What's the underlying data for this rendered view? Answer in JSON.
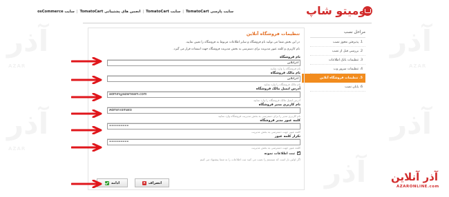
{
  "header": {
    "links": [
      "سایت پارسی TomatoCart",
      "سایت TomatoCart",
      "انجمن های پشتیبانی TomatoCart",
      "سایت osCommerce"
    ],
    "logo_text": "توميتو شاپ"
  },
  "sidebar": {
    "title": "مراحل نصب",
    "steps": [
      "1. پذیرفتن مجوز نصب",
      "2. بررسی قبل از نصب",
      "3. تنظیمات بانک اطلاعات",
      "4. تنظیمات سرور وب",
      "5. تنظیمات فروشگاه آنلاین",
      "6. پایان نصب"
    ]
  },
  "main": {
    "title": "تنظیمات فروشگاه آنلاین",
    "intro_1": "در این بخش شما می توانید نام فروشگاه و سایر اطلاعات مربوط به فروشگاه را تعیین نمایید.",
    "intro_2": "نام کاربری و کلمه عبور مدیریت برای دسترسی به بخش مدیریت فروشگاه جهت استفاده قرار می گیرد."
  },
  "form": {
    "store_name_label": "نام فروشگاه",
    "store_name_value": "آذرآنلاین",
    "store_name_hint": "نام فروشگاه را وارد نمایید",
    "owner_label": "نام مالک فروشگاه",
    "owner_value": "آذرآنلاین",
    "owner_hint": "نام مالک فروشگاه را وارد نمایید",
    "email_label": "آدرس ایمیل مالک فروشگاه",
    "email_value": "admin@azarteam.com",
    "email_hint": "آدرس ایمیل مالک فروشگاه را وارد نمایید",
    "admin_user_label": "نام کاربری مدیر فروشگاه",
    "admin_user_value": "AdminTomato",
    "admin_user_hint": "نام کاربری مدیر را برای دسترسی به بخش مدیریت فروشگاه وارد نمایید",
    "admin_pass_label": "کلمه عبور مدیر فروشگاه",
    "admin_pass_value": "••••••••••",
    "admin_pass_hint": "کلمه عبور جهت دسترسی به بخش مدیریت",
    "confirm_label": "تکرار کلمه عبور",
    "confirm_value": "••••••••••",
    "confirm_hint": "کلمه عبور جهت دسترسی به بخش مدیریت",
    "sample_label": "ثبت اطلاعات نمونه",
    "sample_hint": "اگر اولین بار است که سیستم را نصب می کنید ثبت اطلاعات را به شما پیشنهاد می کنیم"
  },
  "buttons": {
    "next": "ادامه",
    "cancel": "انصراف"
  },
  "brand": {
    "name": "آذر آنلاین",
    "domain": "AZARONLINE.com"
  },
  "colors": {
    "accent": "#f28c1e",
    "brand_red": "#d12b2b",
    "arrow_red": "#e0161b"
  }
}
